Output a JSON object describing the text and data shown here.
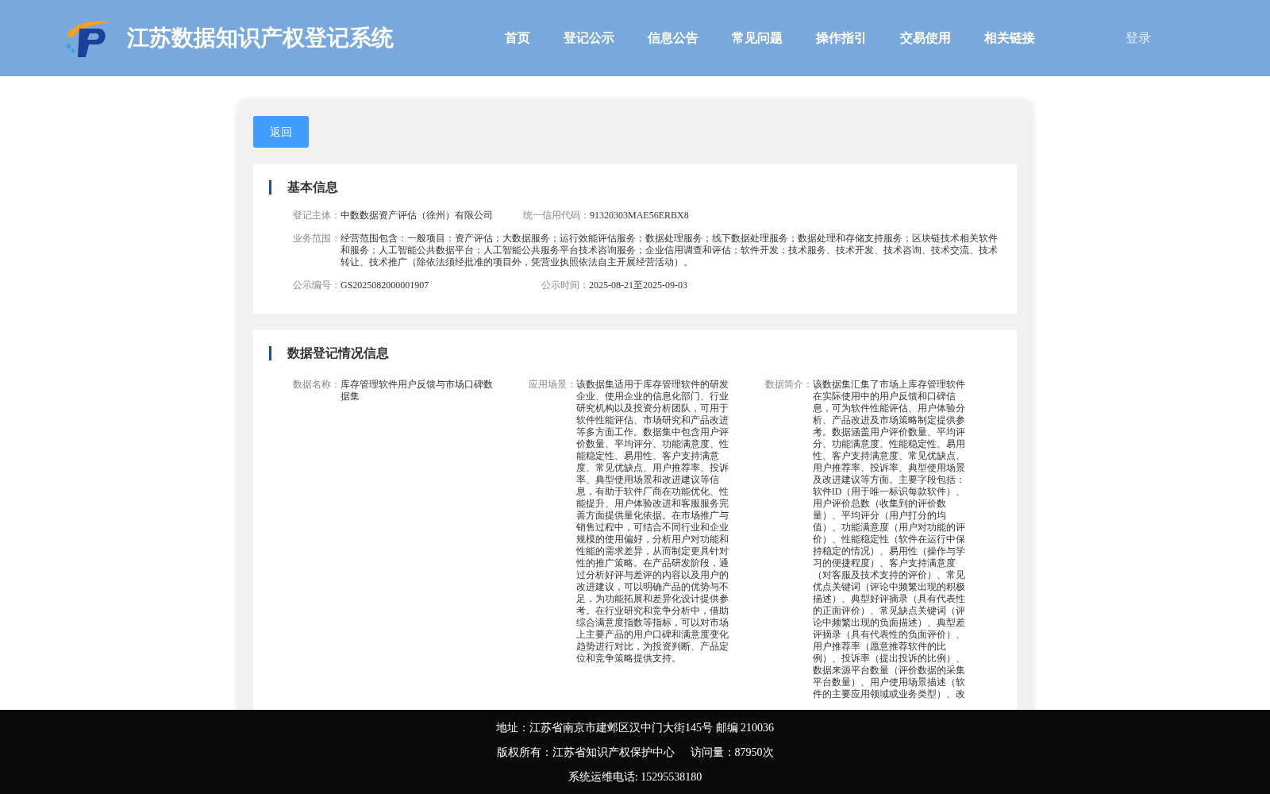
{
  "header": {
    "title": "江苏数据知识产权登记系统",
    "nav": [
      "首页",
      "登记公示",
      "信息公告",
      "常见问题",
      "操作指引",
      "交易使用",
      "相关链接"
    ],
    "login": "登录"
  },
  "back_button": "返回",
  "basic_info": {
    "title": "基本信息",
    "fields": [
      {
        "label": "登记主体：",
        "value": "中数数据资产评估（徐州）有限公司"
      },
      {
        "label": "统一信用代码：",
        "value": "91320303MAE56ERBX8"
      }
    ],
    "scope": {
      "label": "业务范围：",
      "value": "经营范围包含：一般项目：资产评估；大数据服务；运行效能评估服务；数据处理服务；线下数据处理服务；数据处理和存储支持服务；区块链技术相关软件和服务；人工智能公共数据平台；人工智能公共服务平台技术咨询服务；企业信用调查和评估；软件开发；技术服务、技术开发、技术咨询、技术交流、技术转让、技术推广（除依法须经批准的项目外，凭营业执照依法自主开展经营活动）。"
    },
    "fields2": [
      {
        "label": "公示编号：",
        "value": "GS2025082000001907"
      },
      {
        "label": "公示时间：",
        "value": "2025-08-21至2025-09-03"
      }
    ]
  },
  "data_info": {
    "title": "数据登记情况信息",
    "columns": [
      {
        "label": "数据名称：",
        "value": "库存管理软件用户反馈与市场口碑数据集"
      },
      {
        "label": "应用场景：",
        "value": "该数据集适用于库存管理软件的研发企业、使用企业的信息化部门、行业研究机构以及投资分析团队，可用于软件性能评估、市场研究和产品改进等多方面工作。数据集中包含用户评价数量、平均评分、功能满意度、性能稳定性、易用性、客户支持满意度、常见优缺点、用户推荐率、投诉率、典型使用场景和改进建议等信息，有助于软件厂商在功能优化、性能提升、用户体验改进和客服服务完善方面提供量化依据。在市场推广与销售过程中，可结合不同行业和企业规模的使用偏好，分析用户对功能和性能的需求差异，从而制定更具针对性的推广策略。在产品研发阶段，通过分析好评与差评的内容以及用户的改进建议，可以明确产品的优势与不足，为功能拓展和差异化设计提供参考。在行业研究和竞争分析中，借助综合满意度指数等指标，可以对市场上主要产品的用户口碑和满意度变化趋势进行对比，为投资判断、产品定位和竞争策略提供支持。"
      },
      {
        "label": "数据简介：",
        "value": "该数据集汇集了市场上库存管理软件在实际使用中的用户反馈和口碑信息，可为软件性能评估、用户体验分析、产品改进及市场策略制定提供参考。数据涵盖用户评价数量、平均评分、功能满意度、性能稳定性、易用性、客户支持满意度、常见优缺点、用户推荐率、投诉率、典型使用场景及改进建议等方面。主要字段包括：软件ID（用于唯一标识每款软件）、用户评价总数（收集到的评价数量）、平均评分（用户打分的均值）、功能满意度（用户对功能的评价）、性能稳定性（软件在运行中保持稳定的情况）、易用性（操作与学习的便捷程度）、客户支持满意度（对客服及技术支持的评价）、常见优点关键词（评论中频繁出现的积极描述）、典型好评摘录（具有代表性的正面评价）、常见缺点关键词（评论中频繁出现的负面描述）、典型差评摘录（具有代表性的负面评价）、用户推荐率（愿意推荐软件的比例）、投诉率（提出投诉的比例）、数据来源平台数量（评价数据的采集平台数量）、用户使用场景描述（软件的主要应用领域或业务类型）、改"
      }
    ]
  },
  "footer": {
    "address": "地址：江苏省南京市建邺区汉中门大街145号 邮编 210036",
    "copyright": "版权所有：江苏省知识产权保护中心",
    "visits": "访问量：87950次",
    "phone": "系统运维电话: 15295538180"
  }
}
